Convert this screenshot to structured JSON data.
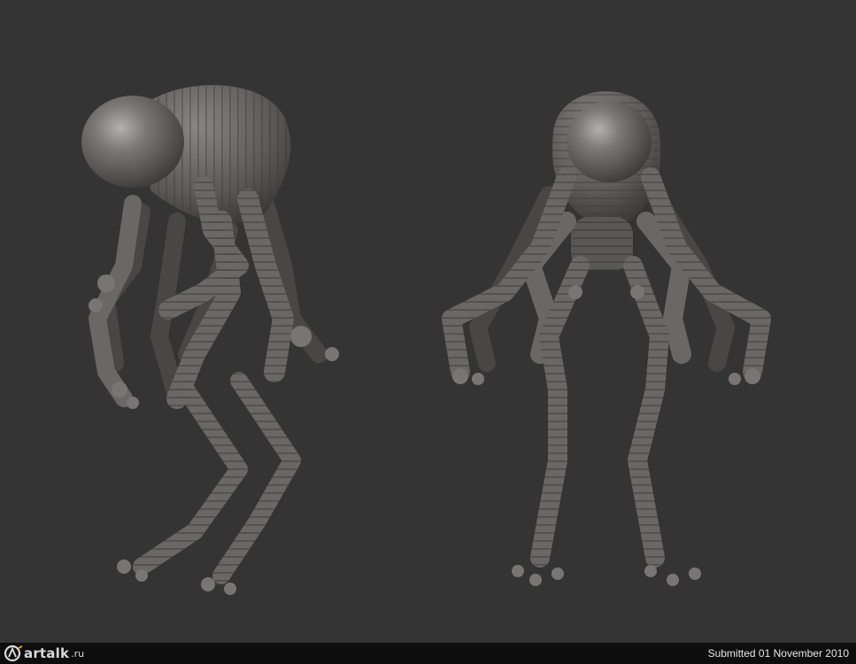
{
  "footer": {
    "logo": {
      "name": "artalk",
      "tld": ".ru"
    },
    "submitted_text": "Submitted 01 November 2010"
  },
  "scene": {
    "subject": "two views of a grey sculpted creature",
    "icons": [
      "artalk-logo-icon"
    ],
    "colors": {
      "background": "#343434",
      "footer": "#0d0d0d",
      "clay": "#6b6767",
      "clay_shadow": "#3e3b3b",
      "clay_highlight": "#a6a2a2",
      "text": "#e6e6e6"
    }
  }
}
